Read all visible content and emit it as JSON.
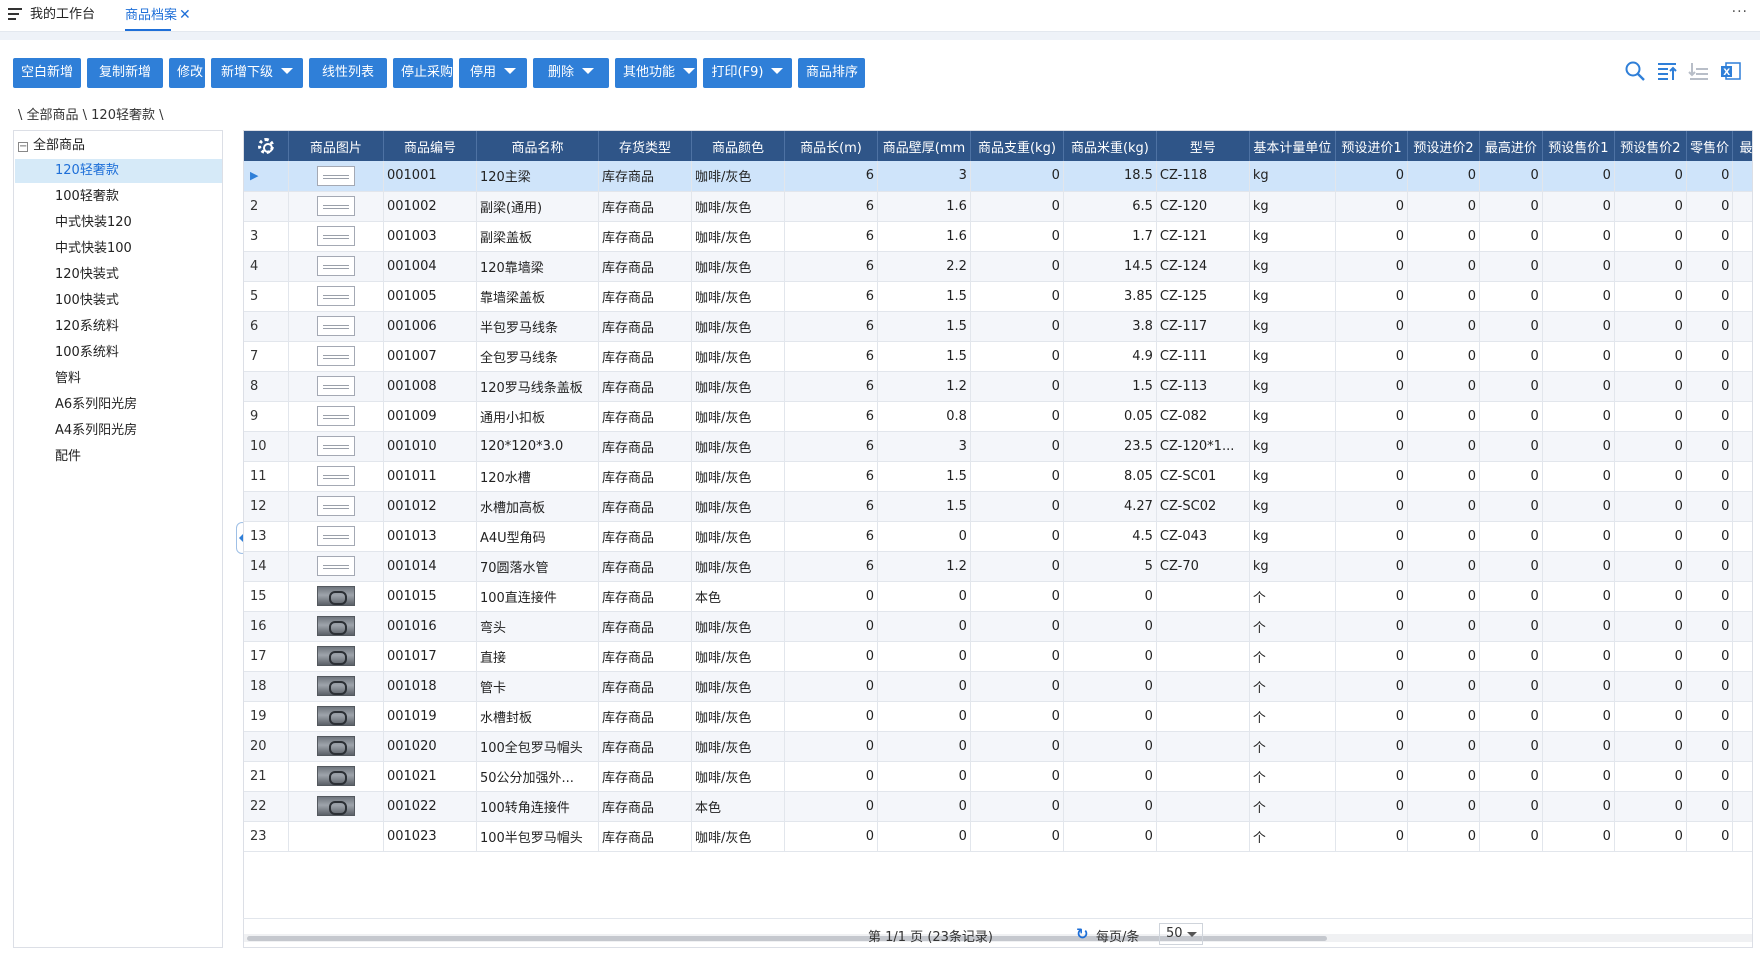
{
  "tabs": {
    "home": "我的工作台",
    "active": "商品档案",
    "close": "✕",
    "more": "···"
  },
  "toolbar": {
    "buttons": [
      {
        "label": "空白新增",
        "dropdown": false
      },
      {
        "label": "复制新增",
        "dropdown": false
      },
      {
        "label": "修改",
        "dropdown": false
      },
      {
        "label": "新增下级",
        "dropdown": true
      },
      {
        "label": "线性列表",
        "dropdown": false
      },
      {
        "label": "停止采购",
        "dropdown": false
      },
      {
        "label": "停用",
        "dropdown": true
      },
      {
        "label": "删除",
        "dropdown": true
      },
      {
        "label": "其他功能",
        "dropdown": true
      },
      {
        "label": "打印(F9)",
        "dropdown": true
      },
      {
        "label": "商品排序",
        "dropdown": false
      }
    ],
    "icons": [
      "search-icon",
      "sort-desc-icon",
      "sort-asc-icon",
      "excel-icon"
    ]
  },
  "breadcrumb": "\\ 全部商品 \\ 120轻奢款 \\",
  "tree": {
    "root": "全部商品",
    "items": [
      "120轻奢款",
      "100轻奢款",
      "中式快装120",
      "中式快装100",
      "120快装式",
      "100快装式",
      "120系统料",
      "100系统料",
      "管料",
      "A6系列阳光房",
      "A4系列阳光房",
      "配件"
    ],
    "selected_index": 0
  },
  "grid": {
    "columns": [
      "商品图片",
      "商品编号",
      "商品名称",
      "存货类型",
      "商品颜色",
      "商品长(m)",
      "商品壁厚(mm",
      "商品支重(kg)",
      "商品米重(kg)",
      "型号",
      "基本计量单位",
      "预设进价1",
      "预设进价2",
      "最高进价",
      "预设售价1",
      "预设售价2",
      "零售价",
      "最高售价",
      "最"
    ],
    "rows": [
      {
        "idx": "",
        "pic": "line",
        "code": "001001",
        "name": "120主梁",
        "type": "库存商品",
        "color": "咖啡/灰色",
        "len": "6",
        "wall": "3",
        "wt": "0",
        "mwt": "18.5",
        "model": "CZ-118",
        "unit": "kg"
      },
      {
        "idx": "2",
        "pic": "line",
        "code": "001002",
        "name": "副梁(通用)",
        "type": "库存商品",
        "color": "咖啡/灰色",
        "len": "6",
        "wall": "1.6",
        "wt": "0",
        "mwt": "6.5",
        "model": "CZ-120",
        "unit": "kg"
      },
      {
        "idx": "3",
        "pic": "line",
        "code": "001003",
        "name": "副梁盖板",
        "type": "库存商品",
        "color": "咖啡/灰色",
        "len": "6",
        "wall": "1.6",
        "wt": "0",
        "mwt": "1.7",
        "model": "CZ-121",
        "unit": "kg"
      },
      {
        "idx": "4",
        "pic": "line",
        "code": "001004",
        "name": "120靠墙梁",
        "type": "库存商品",
        "color": "咖啡/灰色",
        "len": "6",
        "wall": "2.2",
        "wt": "0",
        "mwt": "14.5",
        "model": "CZ-124",
        "unit": "kg"
      },
      {
        "idx": "5",
        "pic": "line",
        "code": "001005",
        "name": "靠墙梁盖板",
        "type": "库存商品",
        "color": "咖啡/灰色",
        "len": "6",
        "wall": "1.5",
        "wt": "0",
        "mwt": "3.85",
        "model": "CZ-125",
        "unit": "kg"
      },
      {
        "idx": "6",
        "pic": "line",
        "code": "001006",
        "name": "半包罗马线条",
        "type": "库存商品",
        "color": "咖啡/灰色",
        "len": "6",
        "wall": "1.5",
        "wt": "0",
        "mwt": "3.8",
        "model": "CZ-117",
        "unit": "kg"
      },
      {
        "idx": "7",
        "pic": "line",
        "code": "001007",
        "name": "全包罗马线条",
        "type": "库存商品",
        "color": "咖啡/灰色",
        "len": "6",
        "wall": "1.5",
        "wt": "0",
        "mwt": "4.9",
        "model": "CZ-111",
        "unit": "kg"
      },
      {
        "idx": "8",
        "pic": "line",
        "code": "001008",
        "name": "120罗马线条盖板",
        "type": "库存商品",
        "color": "咖啡/灰色",
        "len": "6",
        "wall": "1.2",
        "wt": "0",
        "mwt": "1.5",
        "model": "CZ-113",
        "unit": "kg"
      },
      {
        "idx": "9",
        "pic": "line",
        "code": "001009",
        "name": "通用小扣板",
        "type": "库存商品",
        "color": "咖啡/灰色",
        "len": "6",
        "wall": "0.8",
        "wt": "0",
        "mwt": "0.05",
        "model": "CZ-082",
        "unit": "kg"
      },
      {
        "idx": "10",
        "pic": "line",
        "code": "001010",
        "name": "120*120*3.0",
        "type": "库存商品",
        "color": "咖啡/灰色",
        "len": "6",
        "wall": "3",
        "wt": "0",
        "mwt": "23.5",
        "model": "CZ-120*1...",
        "unit": "kg"
      },
      {
        "idx": "11",
        "pic": "line",
        "code": "001011",
        "name": "120水槽",
        "type": "库存商品",
        "color": "咖啡/灰色",
        "len": "6",
        "wall": "1.5",
        "wt": "0",
        "mwt": "8.05",
        "model": "CZ-SC01",
        "unit": "kg"
      },
      {
        "idx": "12",
        "pic": "line",
        "code": "001012",
        "name": "水槽加高板",
        "type": "库存商品",
        "color": "咖啡/灰色",
        "len": "6",
        "wall": "1.5",
        "wt": "0",
        "mwt": "4.27",
        "model": "CZ-SC02",
        "unit": "kg"
      },
      {
        "idx": "13",
        "pic": "line",
        "code": "001013",
        "name": "A4U型角码",
        "type": "库存商品",
        "color": "咖啡/灰色",
        "len": "6",
        "wall": "0",
        "wt": "0",
        "mwt": "4.5",
        "model": "CZ-043",
        "unit": "kg"
      },
      {
        "idx": "14",
        "pic": "line",
        "code": "001014",
        "name": "70圆落水管",
        "type": "库存商品",
        "color": "咖啡/灰色",
        "len": "6",
        "wall": "1.2",
        "wt": "0",
        "mwt": "5",
        "model": "CZ-70",
        "unit": "kg"
      },
      {
        "idx": "15",
        "pic": "photo",
        "code": "001015",
        "name": "100直连接件",
        "type": "库存商品",
        "color": "本色",
        "len": "0",
        "wall": "0",
        "wt": "0",
        "mwt": "0",
        "model": "",
        "unit": "个"
      },
      {
        "idx": "16",
        "pic": "photo",
        "code": "001016",
        "name": "弯头",
        "type": "库存商品",
        "color": "咖啡/灰色",
        "len": "0",
        "wall": "0",
        "wt": "0",
        "mwt": "0",
        "model": "",
        "unit": "个"
      },
      {
        "idx": "17",
        "pic": "photo",
        "code": "001017",
        "name": "直接",
        "type": "库存商品",
        "color": "咖啡/灰色",
        "len": "0",
        "wall": "0",
        "wt": "0",
        "mwt": "0",
        "model": "",
        "unit": "个"
      },
      {
        "idx": "18",
        "pic": "photo",
        "code": "001018",
        "name": "管卡",
        "type": "库存商品",
        "color": "咖啡/灰色",
        "len": "0",
        "wall": "0",
        "wt": "0",
        "mwt": "0",
        "model": "",
        "unit": "个"
      },
      {
        "idx": "19",
        "pic": "photo",
        "code": "001019",
        "name": "水槽封板",
        "type": "库存商品",
        "color": "咖啡/灰色",
        "len": "0",
        "wall": "0",
        "wt": "0",
        "mwt": "0",
        "model": "",
        "unit": "个"
      },
      {
        "idx": "20",
        "pic": "photo",
        "code": "001020",
        "name": "100全包罗马帽头",
        "type": "库存商品",
        "color": "咖啡/灰色",
        "len": "0",
        "wall": "0",
        "wt": "0",
        "mwt": "0",
        "model": "",
        "unit": "个"
      },
      {
        "idx": "21",
        "pic": "photo",
        "code": "001021",
        "name": "50公分加强外...",
        "type": "库存商品",
        "color": "咖啡/灰色",
        "len": "0",
        "wall": "0",
        "wt": "0",
        "mwt": "0",
        "model": "",
        "unit": "个"
      },
      {
        "idx": "22",
        "pic": "photo",
        "code": "001022",
        "name": "100转角连接件",
        "type": "库存商品",
        "color": "本色",
        "len": "0",
        "wall": "0",
        "wt": "0",
        "mwt": "0",
        "model": "",
        "unit": "个"
      },
      {
        "idx": "23",
        "pic": "",
        "code": "001023",
        "name": "100半包罗马帽头",
        "type": "库存商品",
        "color": "咖啡/灰色",
        "len": "0",
        "wall": "0",
        "wt": "0",
        "mwt": "0",
        "model": "",
        "unit": "个"
      }
    ],
    "price_value": "0",
    "selected_marker": "▶"
  },
  "pager": {
    "info": "第 1/1 页 (23条记录)",
    "refresh_icon": "↻",
    "per_page_label": "每页/条",
    "per_page_value": "50"
  },
  "colors": {
    "accent": "#2f7fd8",
    "header": "#2f5588",
    "selected_row": "#cfe4fa"
  }
}
